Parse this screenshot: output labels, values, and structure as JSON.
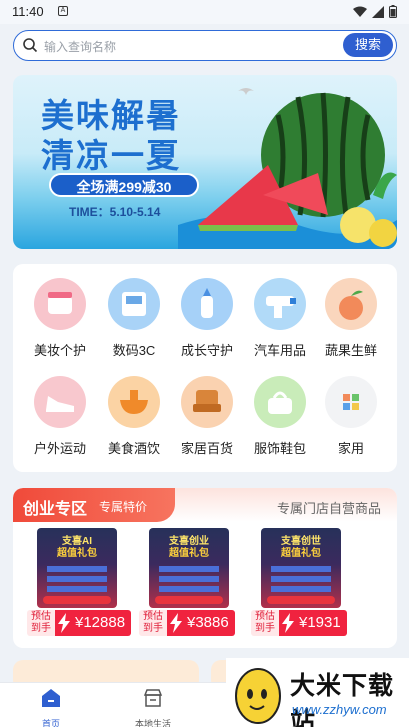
{
  "status": {
    "time": "11:40"
  },
  "search": {
    "placeholder": "输入查询名称",
    "button_label": "搜索"
  },
  "banner": {
    "line1": "美味解暑",
    "line2": "清凉一夏",
    "promo": "全场满299减30",
    "time": "TIME：5.10-5.14"
  },
  "categories": [
    {
      "label": "美妆个护",
      "icon": "cosmetics-icon",
      "color": "#f7b6c0"
    },
    {
      "label": "数码3C",
      "icon": "printer-icon",
      "color": "#8fc5f5"
    },
    {
      "label": "成长守护",
      "icon": "baby-bottle-icon",
      "color": "#8cc8f6"
    },
    {
      "label": "汽车用品",
      "icon": "spray-gun-icon",
      "color": "#98cff6"
    },
    {
      "label": "蔬果生鲜",
      "icon": "peach-icon",
      "color": "#f8c9a7"
    },
    {
      "label": "户外运动",
      "icon": "sneaker-icon",
      "color": "#f8b9c1"
    },
    {
      "label": "美食酒饮",
      "icon": "bowl-icon",
      "color": "#f8c58e"
    },
    {
      "label": "家居百货",
      "icon": "armchair-icon",
      "color": "#f7c59c"
    },
    {
      "label": "服饰鞋包",
      "icon": "handbag-icon",
      "color": "#b9e7a7"
    },
    {
      "label": "家用",
      "icon": "grid-app-icon",
      "color": "#f2f3f5"
    }
  ],
  "zone": {
    "title": "创业专区",
    "subtitle": "专属特价",
    "right_text": "专属门店自营商品",
    "products": [
      {
        "line1": "支喜AI",
        "line2": "超值礼包",
        "estimate": "预估到手",
        "price": "¥12888"
      },
      {
        "line1": "支喜创业",
        "line2": "超值礼包",
        "estimate": "预估到手",
        "price": "¥3886"
      },
      {
        "line1": "支喜创世",
        "line2": "超值礼包",
        "estimate": "预估到手",
        "price": "¥1931"
      }
    ]
  },
  "tabs": [
    {
      "label": "首页",
      "icon": "home-icon",
      "active": true
    },
    {
      "label": "本地生活",
      "icon": "store-icon",
      "active": false
    }
  ],
  "watermark": {
    "brand": "大米下载站",
    "url": "www.zzhyw.com"
  },
  "colors": {
    "accent": "#2f5fd0",
    "price_red": "#f0233f",
    "zone_red": "#f04a3a"
  }
}
